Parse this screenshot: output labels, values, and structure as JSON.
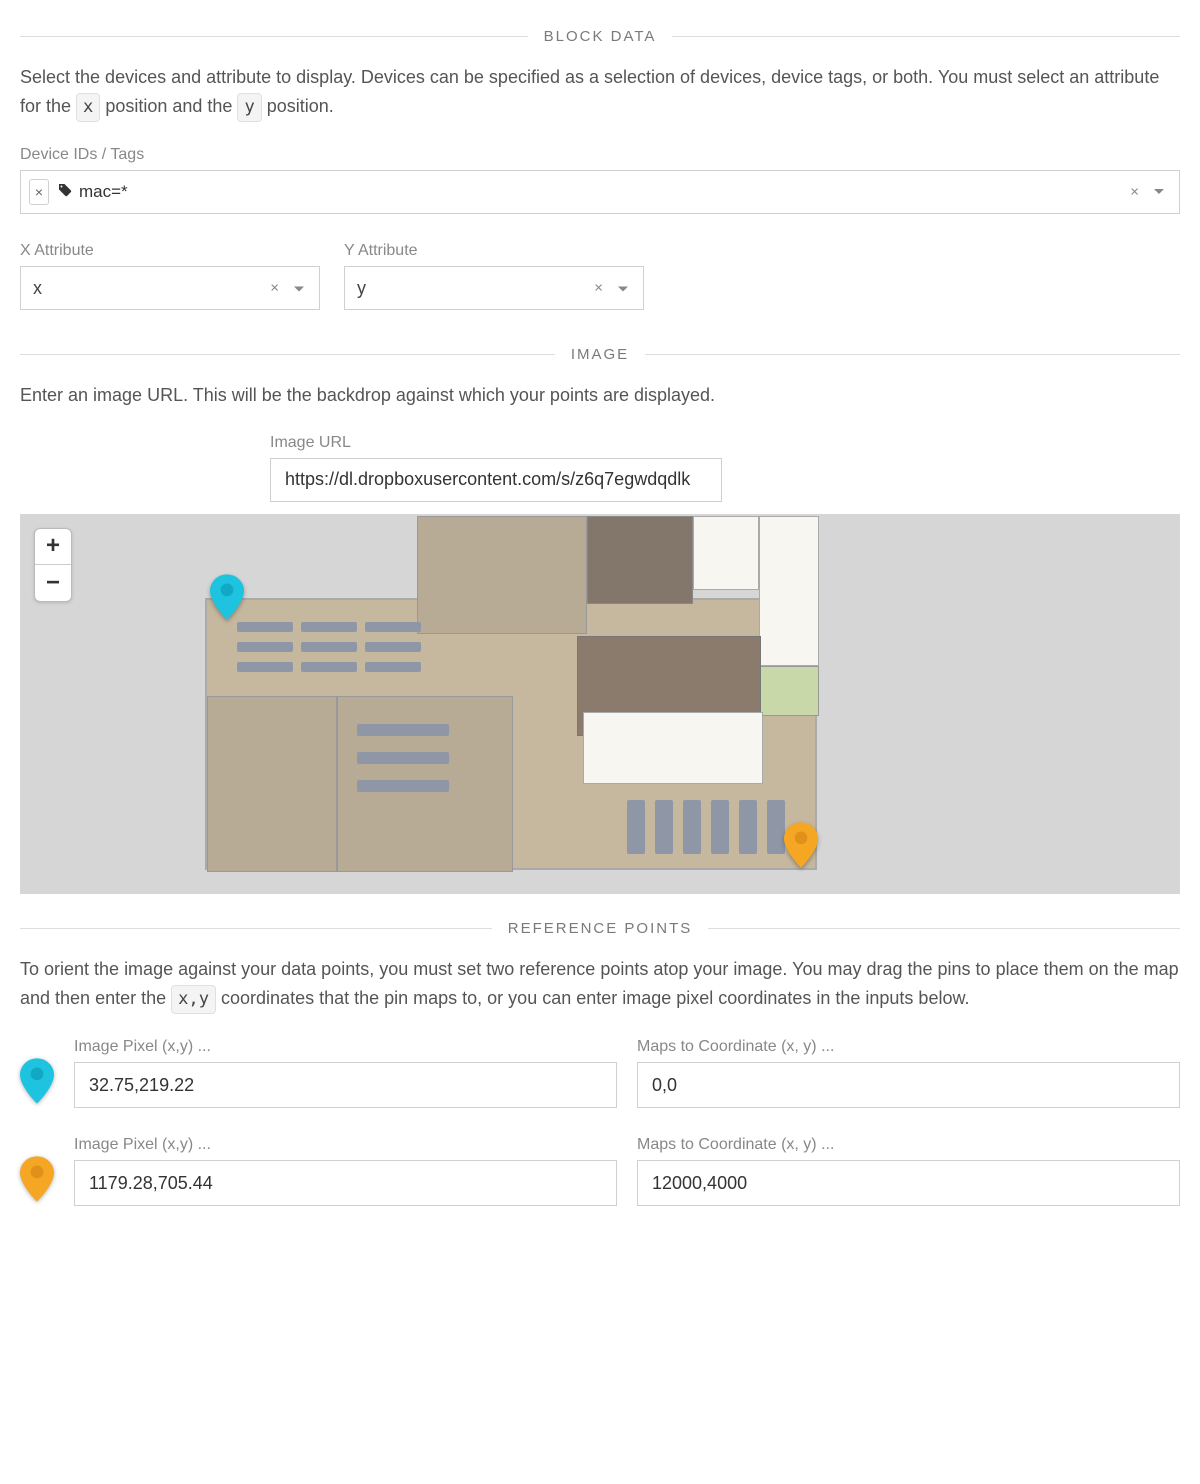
{
  "sections": {
    "block_data": "BLOCK DATA",
    "image": "IMAGE",
    "reference_points": "REFERENCE POINTS"
  },
  "block_data": {
    "help_pre": "Select the devices and attribute to display. Devices can be specified as a selection of devices, device tags, or both. You must select an attribute for the ",
    "help_x_code": "x",
    "help_mid": " position and the ",
    "help_y_code": "y",
    "help_post": " position.",
    "device_label": "Device IDs / Tags",
    "device_tag": "mac=*",
    "x_attr_label": "X Attribute",
    "x_attr_value": "x",
    "y_attr_label": "Y Attribute",
    "y_attr_value": "y"
  },
  "image": {
    "help": "Enter an image URL. This will be the backdrop against which your points are displayed.",
    "url_label": "Image URL",
    "url_value": "https://dl.dropboxusercontent.com/s/z6q7egwdqdlk",
    "zoom_in": "+",
    "zoom_out": "−"
  },
  "reference": {
    "help_pre": "To orient the image against your data points, you must set two reference points atop your image. You may drag the pins to place them on the map and then enter the ",
    "help_code": "x,y",
    "help_post": " coordinates that the pin maps to, or you can enter image pixel coordinates in the inputs below.",
    "pixel_label": "Image Pixel (x,y) ...",
    "coord_label": "Maps to Coordinate (x, y) ...",
    "row1": {
      "pixel": "32.75,219.22",
      "coord": "0,0",
      "color": "#1ec3e0"
    },
    "row2": {
      "pixel": "1179.28,705.44",
      "coord": "12000,4000",
      "color": "#f5a623"
    }
  },
  "icons": {
    "clear": "×",
    "remove": "×"
  }
}
